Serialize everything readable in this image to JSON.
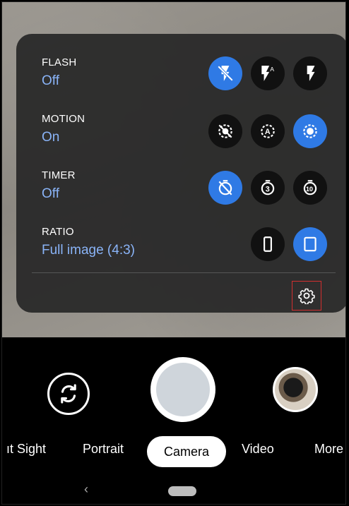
{
  "quick_settings": {
    "flash": {
      "label": "FLASH",
      "value": "Off",
      "options": [
        "flash-off-icon",
        "flash-auto-icon",
        "flash-on-icon"
      ],
      "active_index": 0
    },
    "motion": {
      "label": "MOTION",
      "value": "On",
      "options": [
        "motion-off-icon",
        "motion-auto-icon",
        "motion-on-icon"
      ],
      "active_index": 2
    },
    "timer": {
      "label": "TIMER",
      "value": "Off",
      "options": [
        "timer-off-icon",
        "timer-3s-icon",
        "timer-10s-icon"
      ],
      "active_index": 0
    },
    "ratio": {
      "label": "RATIO",
      "value": "Full image (4:3)",
      "options": [
        "ratio-16-9-icon",
        "ratio-4-3-icon"
      ],
      "active_index": 1
    },
    "flash_auto_glyph": "A",
    "timer_3_glyph": "3",
    "timer_10_glyph": "10",
    "motion_auto_glyph": "A"
  },
  "modes": {
    "night_sight": "ıt Sight",
    "portrait": "Portrait",
    "camera": "Camera",
    "video": "Video",
    "more": "More"
  },
  "nav": {
    "back_glyph": "‹"
  },
  "colors": {
    "accent": "#2f7ae5",
    "value_text": "#8ab4f8",
    "panel": "#282828",
    "highlight_border": "#d32f2f"
  }
}
